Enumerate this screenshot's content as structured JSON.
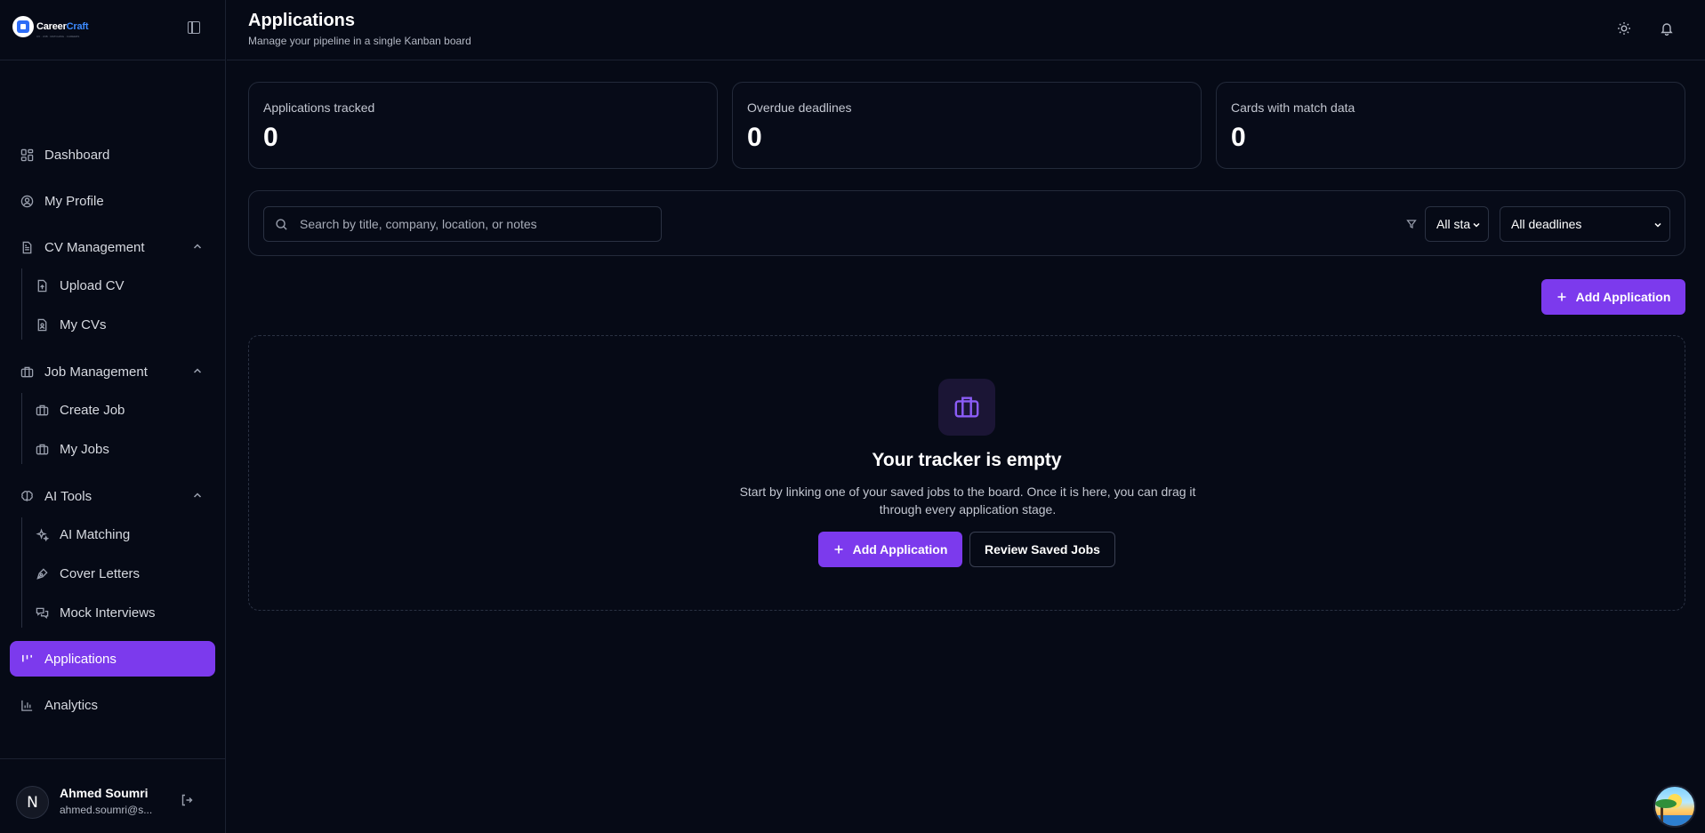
{
  "brand": {
    "name_a": "Career",
    "name_b": "Craft",
    "tagline": "CV · JOB · MATCHING · CAREERS"
  },
  "sidebar": {
    "items": [
      {
        "label": "Dashboard"
      },
      {
        "label": "My Profile"
      },
      {
        "label": "CV Management"
      },
      {
        "label": "Upload CV"
      },
      {
        "label": "My CVs"
      },
      {
        "label": "Job Management"
      },
      {
        "label": "Create Job"
      },
      {
        "label": "My Jobs"
      },
      {
        "label": "AI Tools"
      },
      {
        "label": "AI Matching"
      },
      {
        "label": "Cover Letters"
      },
      {
        "label": "Mock Interviews"
      },
      {
        "label": "Applications"
      },
      {
        "label": "Analytics"
      }
    ]
  },
  "user": {
    "name": "Ahmed Soumri",
    "email": "ahmed.soumri@s...",
    "avatar_initial": "N"
  },
  "header": {
    "title": "Applications",
    "subtitle": "Manage your pipeline in a single Kanban board"
  },
  "stats": [
    {
      "label": "Applications tracked",
      "value": "0"
    },
    {
      "label": "Overdue deadlines",
      "value": "0"
    },
    {
      "label": "Cards with match data",
      "value": "0"
    }
  ],
  "filters": {
    "search_placeholder": "Search by title, company, location, or notes",
    "status_value": "All sta",
    "deadline_value": "All deadlines"
  },
  "actions": {
    "add_application": "Add Application"
  },
  "empty_state": {
    "title": "Your tracker is empty",
    "text": "Start by linking one of your saved jobs to the board. Once it is here, you can drag it through every application stage.",
    "primary": "Add Application",
    "secondary": "Review Saved Jobs"
  },
  "colors": {
    "accent": "#7c3aed",
    "background": "#060a16",
    "border": "#232a3a"
  }
}
